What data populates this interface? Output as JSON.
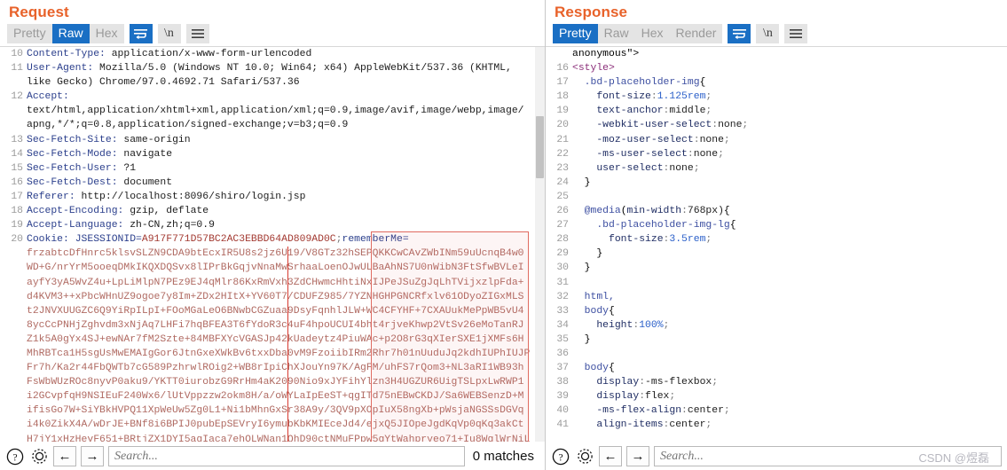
{
  "request": {
    "title": "Request",
    "tabs": [
      {
        "label": "Pretty",
        "active": false
      },
      {
        "label": "Raw",
        "active": true
      },
      {
        "label": "Hex",
        "active": false
      }
    ],
    "icons": [
      {
        "name": "word-wrap-icon",
        "glyph": "↵",
        "active": true
      },
      {
        "name": "newline-icon",
        "glyph": "\\n",
        "active": false
      },
      {
        "name": "menu-icon",
        "glyph": "☰",
        "active": false
      }
    ],
    "first_line_number": 10,
    "lines": [
      {
        "num": "10",
        "text": "Content-Type: application/x-www-form-urlencoded"
      },
      {
        "num": "11",
        "text": "User-Agent: Mozilla/5.0 (Windows NT 10.0; Win64; x64) AppleWebKit/537.36 (KHTML,"
      },
      {
        "num": "",
        "text": "like Gecko) Chrome/97.0.4692.71 Safari/537.36"
      },
      {
        "num": "12",
        "text": "Accept:"
      },
      {
        "num": "",
        "text": "text/html,application/xhtml+xml,application/xml;q=0.9,image/avif,image/webp,image/"
      },
      {
        "num": "",
        "text": "apng,*/*;q=0.8,application/signed-exchange;v=b3;q=0.9"
      },
      {
        "num": "13",
        "text": "Sec-Fetch-Site: same-origin"
      },
      {
        "num": "14",
        "text": "Sec-Fetch-Mode: navigate"
      },
      {
        "num": "15",
        "text": "Sec-Fetch-User: ?1"
      },
      {
        "num": "16",
        "text": "Sec-Fetch-Dest: document"
      },
      {
        "num": "17",
        "text": "Referer: http://localhost:8096/shiro/login.jsp"
      },
      {
        "num": "18",
        "text": "Accept-Encoding: gzip, deflate"
      },
      {
        "num": "19",
        "text": "Accept-Language: zh-CN,zh;q=0.9"
      },
      {
        "num": "20",
        "text": "Cookie: JSESSIONID=A917F771D57BC2AC3EBBD64AD809AD0C;rememberMe="
      }
    ],
    "cookie_header_name": "Cookie: ",
    "jsessionid_key": "JSESSIONID=",
    "jsessionid_value": "A917F771D57BC2AC3EBBD64AD809AD0C",
    "cookie_separator": ";",
    "rememberme_key": "rememberMe=",
    "blob_lines": [
      "frzabtcDfHnrc5klsvSLZN9CDA9btEcxIR5U8s2jz6U19/V8GTz32hSEPQKKCwCAvZWbINm59uUcnqB4w0",
      "WD+G/nrYrM5ooeqDMkIKQXDQSvx8lIPrBkGqjvNnaMwSrhaaLoenOJwULBaAhNS7U0nWibN3FtSfwBVLeI",
      "ayfY3yA5WvZ4u+LpLiMlpN7PEz9EJ4qMlr86KxRmVxh3ZdCHwmcHhtiNxIJPeJSuZgJqLhTVijxzlpFda+",
      "d4KVM3++xPbcWHnUZ9ogoe7y8Im+ZDx2HItX+YV60T7/CDUFZ985/7YZNHGHPGNCRfxlv61ODyoZIGxMLS",
      "t2JNVXUUGZC6Q9YiRpILpI+FOoMGaLeO6BNwbCGZuaa9DsyFqnhlJLW+WC4CFYHF+7CXAUukMePpWB5vU4",
      "8ycCcPNHjZghvdm3xNjAq7LHFi7hqBFEA3T6fYdoR3c4uF4hpoUCUI4bht4rjveKhwp2VtSv26eMoTanRJ",
      "Z1k5A0gYx4SJ+ewNAr7fM2Szte+84MBFXYcVGASJp42kUadeytz4PiuWAc+p2O8rG3qXIerSXE1jXMFs6H",
      "MhRBTca1H5sgUsMwEMAIgGor6JtnGxeXWkBv6txxDba0vM9FzoiibIRm2Rhr7h01nUuduJq2kdhIUPhIUJP",
      "Fr7h/Ka2r44FbQWTb7cG589PzhrwlROig2+WB8rIpiChXJouYn97K/AgFM/uhFS7rQom3+NL3aRI1WB93h",
      "FsWbWUzROc8nyvP0aku9/YKTT0iurobzG9RrHm4aK2090Nio9xJYFihYlzn3H4UGZUR6UigTSLpxLwRWP1",
      "i2GCvpfqH9NSIEuF240Wx6/lUtVppzzw2okm8H/a/oWYLaIpEeST+qgITd75nEBwCKDJ/Sa6WEBSenzD+M",
      "ifisGo7W+SiYBkHVPQ11XpWeUw5Zg0L1+Ni1bMhnGxSr38A9y/3QV9pXOpIuX58ngXb+pWsjaNGSSsDGVq",
      "i4k0ZikX4A/wDrJE+BNf8i6BPIJ0pubEpSEVryI6ymubKbKMIEceJd4/ejxQ5JIOpeJgdKqVp0qKq3akCt",
      "H7jY1xHzHevF651+BRtjZX1DYI5agIaca7ehOLWNan1QhD90ctNMuFPpw5gYtWahpryeo71+Iu8WglWrNiL"
    ],
    "search": {
      "placeholder": "Search...",
      "matches_label": "0 matches",
      "help_icon": "question-circle-icon",
      "settings_icon": "gear-icon",
      "prev_icon": "←",
      "next_icon": "→"
    }
  },
  "response": {
    "title": "Response",
    "tabs": [
      {
        "label": "Pretty",
        "active": true
      },
      {
        "label": "Raw",
        "active": false
      },
      {
        "label": "Hex",
        "active": false
      },
      {
        "label": "Render",
        "active": false
      }
    ],
    "icons": [
      {
        "name": "word-wrap-icon",
        "glyph": "↵",
        "active": true
      },
      {
        "name": "newline-icon",
        "glyph": "\\n",
        "active": false
      },
      {
        "name": "menu-icon",
        "glyph": "☰",
        "active": false
      }
    ],
    "lines": [
      {
        "num": "",
        "text": "anonymous\">"
      },
      {
        "num": "16",
        "text": "<style>"
      },
      {
        "num": "17",
        "text": "  .bd-placeholder-img{"
      },
      {
        "num": "18",
        "text": "    font-size:1.125rem;"
      },
      {
        "num": "19",
        "text": "    text-anchor:middle;"
      },
      {
        "num": "20",
        "text": "    -webkit-user-select:none;"
      },
      {
        "num": "21",
        "text": "    -moz-user-select:none;"
      },
      {
        "num": "22",
        "text": "    -ms-user-select:none;"
      },
      {
        "num": "23",
        "text": "    user-select:none;"
      },
      {
        "num": "24",
        "text": "  }"
      },
      {
        "num": "25",
        "text": ""
      },
      {
        "num": "26",
        "text": "  @media(min-width:768px){"
      },
      {
        "num": "27",
        "text": "    .bd-placeholder-img-lg{"
      },
      {
        "num": "28",
        "text": "      font-size:3.5rem;"
      },
      {
        "num": "29",
        "text": "    }"
      },
      {
        "num": "30",
        "text": "  }"
      },
      {
        "num": "31",
        "text": ""
      },
      {
        "num": "32",
        "text": "  html,"
      },
      {
        "num": "33",
        "text": "  body{"
      },
      {
        "num": "34",
        "text": "    height:100%;"
      },
      {
        "num": "35",
        "text": "  }"
      },
      {
        "num": "36",
        "text": ""
      },
      {
        "num": "37",
        "text": "  body{"
      },
      {
        "num": "38",
        "text": "    display:-ms-flexbox;"
      },
      {
        "num": "39",
        "text": "    display:flex;"
      },
      {
        "num": "40",
        "text": "    -ms-flex-align:center;"
      },
      {
        "num": "41",
        "text": "    align-items:center;"
      }
    ],
    "search": {
      "placeholder": "Search...",
      "help_icon": "question-circle-icon",
      "settings_icon": "gear-icon",
      "prev_icon": "←",
      "next_icon": "→"
    },
    "watermark": "CSDN @煜磊"
  },
  "colors": {
    "accent": "#e8622a",
    "tab_active": "#1a6fc4",
    "selection_border": "#e06a60",
    "caret": "#d83b30",
    "header_name": "#2b3f8c",
    "blob": "#b06a62",
    "css_property": "#1f2d63",
    "number": "#2a5fc9",
    "tag": "#8b2f7a"
  }
}
